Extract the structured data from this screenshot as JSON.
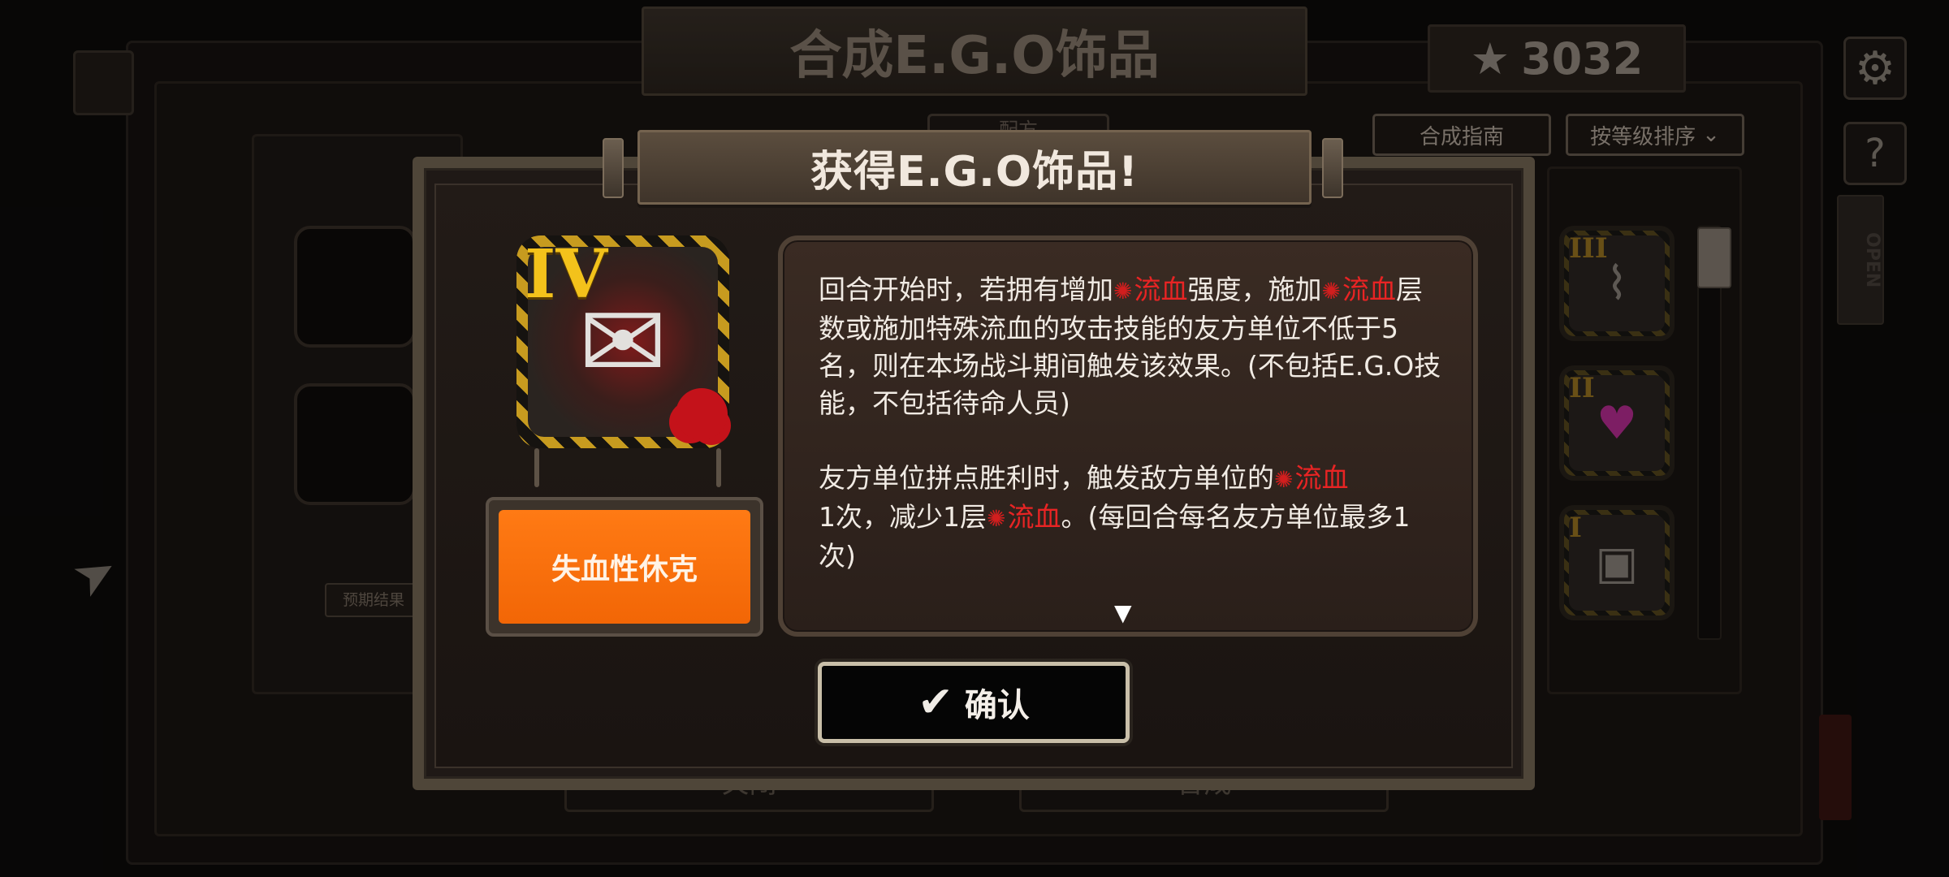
{
  "background": {
    "screen_title": "合成E.G.O饰品",
    "star_count": "3032",
    "guide_label": "合成指南",
    "sort_label": "按等级排序",
    "recipe_tab_label": "配方",
    "expected_result_label": "预期结果",
    "left_bottom_button": "关闭",
    "right_bottom_button": "合成",
    "open_sign": "OPEN",
    "list_items": [
      {
        "rank": "III",
        "icon": "whip-icon"
      },
      {
        "rank": "II",
        "icon": "pink-shoes-icon"
      },
      {
        "rank": "I",
        "icon": "black-bag-icon"
      }
    ]
  },
  "modal": {
    "title": "获得E.G.O饰品!",
    "item": {
      "rank": "IV",
      "name": "失血性休克",
      "icon": "bloody-papers-icon"
    },
    "description": {
      "p1_a": "回合开始时，若拥有增加",
      "p1_kw1": "流血",
      "p1_b": "强度，施加",
      "p1_kw2": "流血",
      "p1_c": "层数或施加特殊流血的攻击技能的友方单位不低于5名，则在本场战斗期间触发该效果。(不包括E.G.O技能，不包括待命人员)",
      "p2_a": "友方单位拼点胜利时，触发敌方单位的",
      "p2_kw1": "流血",
      "p2_b": "1次，减少1层",
      "p2_kw2": "流血",
      "p2_c": "。(每回合每名友方单位最多1次)"
    },
    "more_indicator": "▼",
    "confirm_label": "确认"
  },
  "colors": {
    "accent_orange": "#f26606",
    "keyword_red": "#e82424",
    "rank_gold": "#f3c21b"
  }
}
